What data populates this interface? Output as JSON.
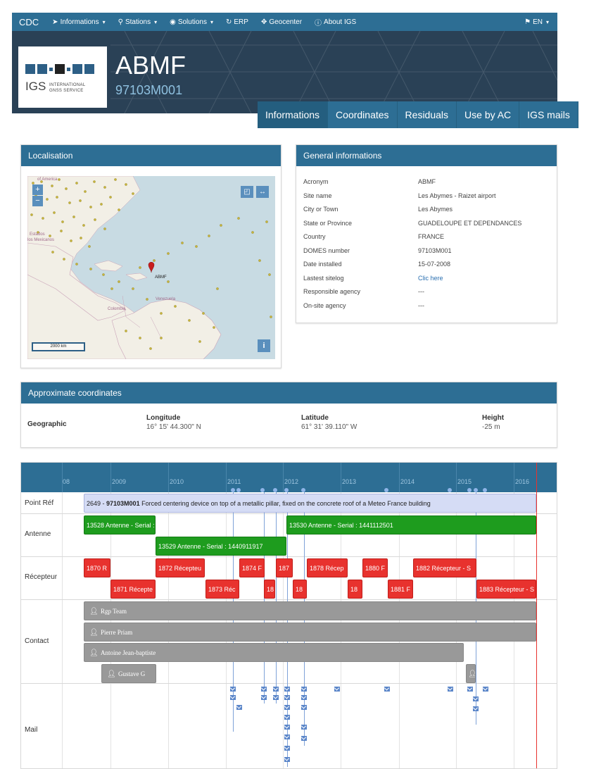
{
  "navbar": {
    "brand": "CDC",
    "items": [
      {
        "label": "Informations",
        "icon": "send-icon",
        "dropdown": true
      },
      {
        "label": "Stations",
        "icon": "map-marker-icon",
        "dropdown": true
      },
      {
        "label": "Solutions",
        "icon": "globe-icon",
        "dropdown": true
      },
      {
        "label": "ERP",
        "icon": "refresh-icon",
        "dropdown": false
      },
      {
        "label": "Geocenter",
        "icon": "crosshair-icon",
        "dropdown": false
      },
      {
        "label": "About IGS",
        "icon": "info-icon",
        "dropdown": false
      }
    ],
    "language": "EN"
  },
  "header": {
    "logo_igs": "IGS",
    "logo_line1": "INTERNATIONAL",
    "logo_line2": "GNSS SERVICE",
    "station_name": "ABMF",
    "domes": "97103M001"
  },
  "tabs": [
    "Informations",
    "Coordinates",
    "Residuals",
    "Use by AC",
    "IGS mails"
  ],
  "localisation": {
    "title": "Localisation",
    "map_labels": {
      "top_left": "of America",
      "mexico1": "Estados",
      "mexico2": "los Mexicanos",
      "station": "ABMF",
      "venezuela": "Venezuela",
      "colombia": "Colombia"
    },
    "scale": "2000 km",
    "zoom_in": "+",
    "zoom_out": "−",
    "info": "i"
  },
  "general": {
    "title": "General informations",
    "rows": [
      {
        "key": "Acronym",
        "value": "ABMF"
      },
      {
        "key": "Site name",
        "value": "Les Abymes - Raizet airport"
      },
      {
        "key": "City or Town",
        "value": "Les Abymes"
      },
      {
        "key": "State or Province",
        "value": "GUADELOUPE ET DEPENDANCES"
      },
      {
        "key": "Country",
        "value": "FRANCE"
      },
      {
        "key": "DOMES number",
        "value": "97103M001"
      },
      {
        "key": "Date installed",
        "value": "15-07-2008"
      },
      {
        "key": "Lastest sitelog",
        "value": "Clic here"
      },
      {
        "key": "Responsible agency",
        "value": "---"
      },
      {
        "key": "On-site agency",
        "value": "---"
      }
    ]
  },
  "approx": {
    "title": "Approximate coordinates",
    "geographic": "Geographic",
    "longitude_label": "Longitude",
    "longitude_value": "16° 15' 44.300\" N",
    "latitude_label": "Latitude",
    "latitude_value": "61° 31' 39.110\" W",
    "height_label": "Height",
    "height_value": "-25 m"
  },
  "timeline": {
    "years": [
      "08",
      "2009",
      "2010",
      "2011",
      "2012",
      "2013",
      "2014",
      "2015",
      "2016"
    ],
    "rows": [
      "Point Réf",
      "Antenne",
      "Récepteur",
      "Contact",
      "Mail"
    ],
    "ref_bar": {
      "id": "2649 - ",
      "domes": "97103M001",
      "text": " Forced centering device on top of a metallic pillar, fixed on the concrete roof of a Meteo France building"
    },
    "antennas": [
      "13528 Antenne - Serial :",
      "13530 Antenne - Serial : 1441112501",
      "13529 Antenne - Serial : 1440911917"
    ],
    "receivers_top": [
      "1870 R",
      "1872 Récepteu",
      "1874 F",
      "187",
      "1878 Récep",
      "1880 F",
      "1882 Récepteur - S"
    ],
    "receivers_bottom": [
      "1871 Récepte",
      "1873 Réc",
      "18",
      "18",
      "18",
      "1881 F",
      "1883 Récepteur - S"
    ],
    "contacts": [
      "Rgp Team",
      "Pierre Priam",
      "Antoine Jean-baptiste",
      "Gustave G"
    ]
  }
}
